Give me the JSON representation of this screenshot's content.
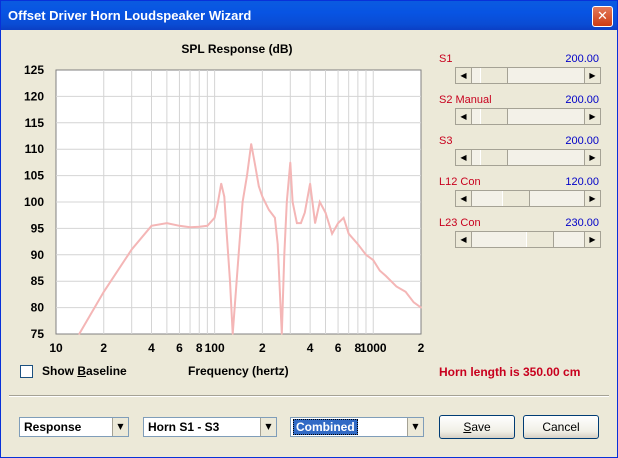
{
  "window": {
    "title": "Offset Driver Horn Loudspeaker Wizard",
    "close_glyph": "✕"
  },
  "chart_data": {
    "type": "line",
    "title": "SPL Response (dB)",
    "xlabel": "Frequency (hertz)",
    "ylabel": "",
    "xscale": "log",
    "xlim": [
      10,
      2000
    ],
    "ylim": [
      75,
      125
    ],
    "yticks": [
      "125",
      "120",
      "115",
      "110",
      "105",
      "100",
      "95",
      "90",
      "85",
      "80",
      "75"
    ],
    "xtick_labels": [
      {
        "f": 10,
        "label": "10"
      },
      {
        "f": 20,
        "label": "2"
      },
      {
        "f": 40,
        "label": "4"
      },
      {
        "f": 60,
        "label": "6"
      },
      {
        "f": 80,
        "label": "8"
      },
      {
        "f": 100,
        "label": "100"
      },
      {
        "f": 200,
        "label": "2"
      },
      {
        "f": 400,
        "label": "4"
      },
      {
        "f": 600,
        "label": "6"
      },
      {
        "f": 800,
        "label": "8"
      },
      {
        "f": 1000,
        "label": "1000"
      },
      {
        "f": 2000,
        "label": "2"
      }
    ],
    "grid": true,
    "series": [
      {
        "color": "#F4B6B6",
        "x": [
          14,
          20,
          30,
          40,
          50,
          60,
          70,
          80,
          90,
          100,
          105,
          110,
          115,
          118,
          125,
          130,
          140,
          150,
          160,
          170,
          180,
          190,
          200,
          220,
          240,
          250,
          265,
          275,
          285,
          300,
          310,
          330,
          350,
          370,
          400,
          430,
          460,
          500,
          550,
          600,
          650,
          700,
          800,
          900,
          1000,
          1100,
          1200,
          1400,
          1600,
          1800,
          2000
        ],
        "y": [
          75,
          83,
          91,
          95.5,
          96,
          95.5,
          95.2,
          95.3,
          95.5,
          97,
          100,
          103.5,
          101,
          96,
          85,
          75,
          88,
          100,
          105,
          111,
          107,
          103,
          101,
          98.5,
          97,
          92,
          75,
          90,
          100,
          107.5,
          100,
          96,
          96,
          98,
          103.5,
          96,
          100,
          98,
          94,
          96,
          97,
          94,
          92,
          90,
          89,
          87,
          86,
          84,
          83,
          81,
          80
        ]
      }
    ]
  },
  "params": [
    {
      "label": "S1",
      "value": "200.00",
      "thumb": 0.1
    },
    {
      "label": "S2 Manual",
      "value": "200.00",
      "thumb": 0.1
    },
    {
      "label": "S3",
      "value": "200.00",
      "thumb": 0.1
    },
    {
      "label": "L12 Con",
      "value": "120.00",
      "thumb": 0.36
    },
    {
      "label": "L23 Con",
      "value": "230.00",
      "thumb": 0.64
    }
  ],
  "controls": {
    "show_baseline_pre": "Show ",
    "show_baseline_key": "B",
    "show_baseline_post": "aseline",
    "horn_length": "Horn length is 350.00 cm"
  },
  "footer": {
    "combo1": "Response",
    "combo2": "Horn S1 - S3",
    "combo3": "Combined",
    "save_key": "S",
    "save_rest": "ave",
    "cancel": "Cancel",
    "dropdown_glyph": "▼",
    "left_arrow": "◀",
    "right_arrow": "▶"
  }
}
